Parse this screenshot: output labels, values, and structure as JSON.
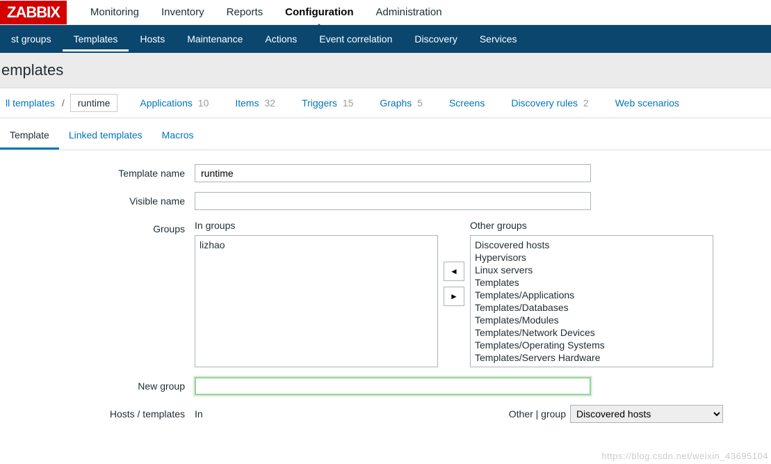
{
  "logo": "ZABBIX",
  "topnav": {
    "items": [
      "Monitoring",
      "Inventory",
      "Reports",
      "Configuration",
      "Administration"
    ],
    "activeIndex": 3
  },
  "subnav": {
    "items": [
      "st groups",
      "Templates",
      "Hosts",
      "Maintenance",
      "Actions",
      "Event correlation",
      "Discovery",
      "Services"
    ],
    "activeIndex": 1
  },
  "page_title": "emplates",
  "breadcrumb": {
    "all_label": "ll templates",
    "current": "runtime",
    "tabs": [
      {
        "label": "Applications",
        "count": "10"
      },
      {
        "label": "Items",
        "count": "32"
      },
      {
        "label": "Triggers",
        "count": "15"
      },
      {
        "label": "Graphs",
        "count": "5"
      },
      {
        "label": "Screens",
        "count": ""
      },
      {
        "label": "Discovery rules",
        "count": "2"
      },
      {
        "label": "Web scenarios",
        "count": ""
      }
    ]
  },
  "formtabs": {
    "items": [
      "Template",
      "Linked templates",
      "Macros"
    ],
    "activeIndex": 0
  },
  "form": {
    "template_name_label": "Template name",
    "template_name_value": "runtime",
    "visible_name_label": "Visible name",
    "visible_name_value": "",
    "groups_label": "Groups",
    "in_groups_label": "In groups",
    "other_groups_label": "Other groups",
    "in_groups": [
      "lizhao"
    ],
    "other_groups": [
      "Discovered hosts",
      "Hypervisors",
      "Linux servers",
      "Templates",
      "Templates/Applications",
      "Templates/Databases",
      "Templates/Modules",
      "Templates/Network Devices",
      "Templates/Operating Systems",
      "Templates/Servers Hardware"
    ],
    "new_group_label": "New group",
    "new_group_value": "",
    "hosts_label": "Hosts / templates",
    "hosts_in_label": "In",
    "hosts_other_label": "Other | group",
    "hosts_other_selected": "Discovered hosts"
  },
  "watermark": "https://blog.csdn.net/weixin_43695104"
}
